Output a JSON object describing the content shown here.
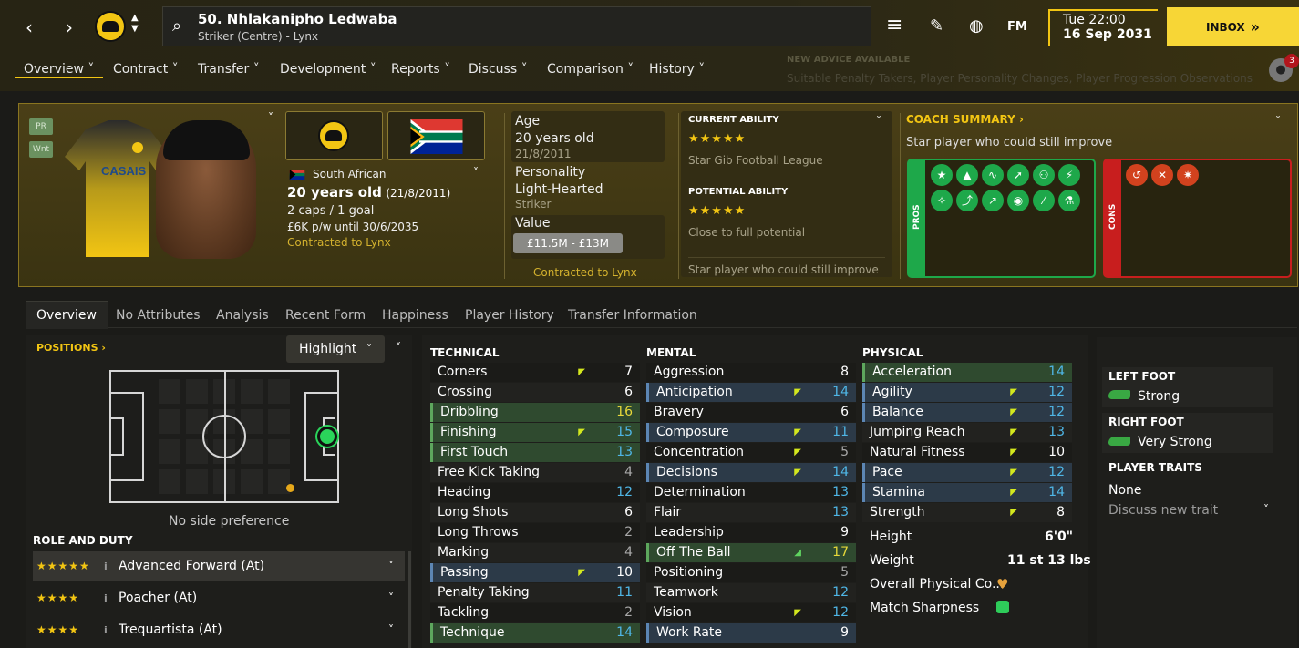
{
  "header": {
    "player_title": "50. Nhlakanipho Ledwaba",
    "player_subtitle": "Striker (Centre) - Lynx",
    "time": "Tue 22:00",
    "date": "16 Sep 2031",
    "inbox_label": "INBOX",
    "inbox_arrow": "»",
    "fm_label": "FM",
    "notification_count": "3",
    "advice_title": "NEW ADVICE AVAILABLE",
    "advice_text": "Suitable Penalty Takers, Player Personality Changes, Player Progression Observations"
  },
  "menu": [
    {
      "label": "Overview",
      "active": true
    },
    {
      "label": "Contract"
    },
    {
      "label": "Transfer"
    },
    {
      "label": "Development"
    },
    {
      "label": "Reports"
    },
    {
      "label": "Discuss"
    },
    {
      "label": "Comparison"
    },
    {
      "label": "History"
    }
  ],
  "profile": {
    "tag_pr": "PR",
    "tag_wnt": "Wnt",
    "shirt_sponsor": "CASAIS",
    "nationality": "South African",
    "age_line": "20 years old",
    "dob_line": "(21/8/2011)",
    "caps": "2 caps / 1 goal",
    "wage": "£6K p/w until 30/6/2035",
    "contracted": "Contracted to Lynx"
  },
  "details": {
    "age_label": "Age",
    "age_value": "20 years old",
    "dob": "21/8/2011",
    "personality_label": "Personality",
    "personality_value": "Light-Hearted",
    "position": "Striker",
    "value_label": "Value",
    "value_range": "£11.5M - £13M",
    "contracted": "Contracted to Lynx"
  },
  "ability": {
    "current_label": "CURRENT ABILITY",
    "current_stars": "★★★★★",
    "current_rating": 4.5,
    "current_note": "Star Gib Football League",
    "potential_label": "POTENTIAL ABILITY",
    "potential_stars": "★★★★★",
    "potential_rating": 4.5,
    "potential_note": "Close to full potential",
    "summary_note": "Star player who could still improve"
  },
  "coach": {
    "title": "COACH SUMMARY",
    "text": "Star player who could still improve",
    "pros_label": "PROS",
    "cons_label": "CONS",
    "pros_icons": [
      "star-icon",
      "cones-icon",
      "stamina-icon",
      "speed-icon",
      "dribble-icon",
      "lightning-icon",
      "agility-icon",
      "jump-icon",
      "growth-icon",
      "head-icon",
      "pitch-icon",
      "flask-icon"
    ],
    "cons_icons": [
      "hook-icon",
      "injury-icon",
      "pain-icon"
    ]
  },
  "tabs": [
    "Overview",
    "No Attributes",
    "Analysis",
    "Recent Form",
    "Happiness",
    "Player History",
    "Transfer Information"
  ],
  "positions": {
    "title": "POSITIONS",
    "highlight_label": "Highlight",
    "side_pref": "No side preference",
    "role_title": "ROLE AND DUTY",
    "roles": [
      {
        "name": "Advanced Forward (At)",
        "rating": 4.5
      },
      {
        "name": "Poacher (At)",
        "rating": 4
      },
      {
        "name": "Trequartista (At)",
        "rating": 4
      }
    ],
    "role_star_text": "★★★★★",
    "info_glyph": "i"
  },
  "technical": {
    "title": "TECHNICAL",
    "rows": [
      {
        "name": "Corners",
        "value": "7"
      },
      {
        "name": "Crossing",
        "value": "6"
      },
      {
        "name": "Dribbling",
        "value": "16"
      },
      {
        "name": "Finishing",
        "value": "15"
      },
      {
        "name": "First Touch",
        "value": "13"
      },
      {
        "name": "Free Kick Taking",
        "value": "4"
      },
      {
        "name": "Heading",
        "value": "12"
      },
      {
        "name": "Long Shots",
        "value": "6"
      },
      {
        "name": "Long Throws",
        "value": "2"
      },
      {
        "name": "Marking",
        "value": "4"
      },
      {
        "name": "Passing",
        "value": "10"
      },
      {
        "name": "Penalty Taking",
        "value": "11"
      },
      {
        "name": "Tackling",
        "value": "2"
      },
      {
        "name": "Technique",
        "value": "14"
      }
    ]
  },
  "mental": {
    "title": "MENTAL",
    "rows": [
      {
        "name": "Aggression",
        "value": "8"
      },
      {
        "name": "Anticipation",
        "value": "14"
      },
      {
        "name": "Bravery",
        "value": "6"
      },
      {
        "name": "Composure",
        "value": "11"
      },
      {
        "name": "Concentration",
        "value": "5"
      },
      {
        "name": "Decisions",
        "value": "14"
      },
      {
        "name": "Determination",
        "value": "13"
      },
      {
        "name": "Flair",
        "value": "13"
      },
      {
        "name": "Leadership",
        "value": "9"
      },
      {
        "name": "Off The Ball",
        "value": "17"
      },
      {
        "name": "Positioning",
        "value": "5"
      },
      {
        "name": "Teamwork",
        "value": "12"
      },
      {
        "name": "Vision",
        "value": "12"
      },
      {
        "name": "Work Rate",
        "value": "9"
      }
    ]
  },
  "physical": {
    "title": "PHYSICAL",
    "rows": [
      {
        "name": "Acceleration",
        "value": "14"
      },
      {
        "name": "Agility",
        "value": "12"
      },
      {
        "name": "Balance",
        "value": "12"
      },
      {
        "name": "Jumping Reach",
        "value": "13"
      },
      {
        "name": "Natural Fitness",
        "value": "10"
      },
      {
        "name": "Pace",
        "value": "12"
      },
      {
        "name": "Stamina",
        "value": "14"
      },
      {
        "name": "Strength",
        "value": "8"
      }
    ],
    "height_label": "Height",
    "height_value": "6'0\"",
    "weight_label": "Weight",
    "weight_value": "11 st 13 lbs",
    "condition_label": "Overall Physical Co...",
    "sharpness_label": "Match Sharpness"
  },
  "feet": {
    "left_title": "LEFT FOOT",
    "left_value": "Strong",
    "right_title": "RIGHT FOOT",
    "right_value": "Very Strong",
    "traits_title": "PLAYER TRAITS",
    "traits_value": "None",
    "discuss_label": "Discuss new trait"
  },
  "colors": {
    "accent": "#f2c513",
    "strong_green": "#5da75d",
    "key_blue": "#5c86b4",
    "pros_border": "#1ea84a",
    "cons_border": "#c81e1e"
  }
}
